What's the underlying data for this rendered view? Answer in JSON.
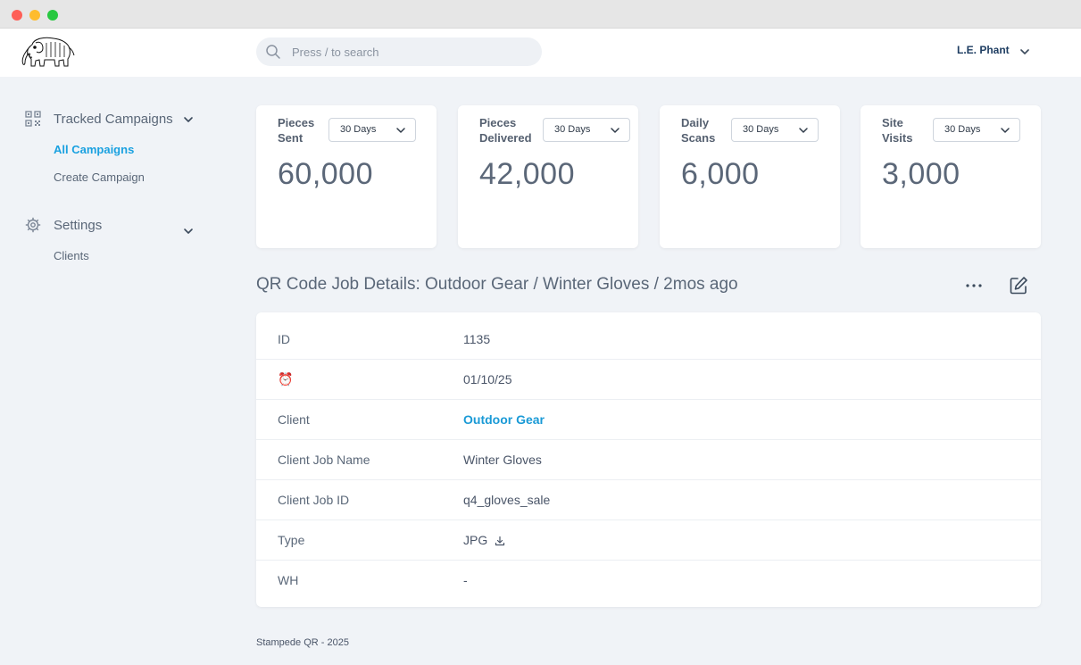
{
  "window": {
    "controls": [
      "close",
      "minimize",
      "zoom"
    ]
  },
  "header": {
    "logo_icon": "elephant-logo-icon",
    "search": {
      "placeholder": "Press / to search",
      "icon": "search-icon"
    },
    "user": {
      "name": "L.E. Phant",
      "icon": "chevron-down-icon"
    }
  },
  "sidebar": {
    "groups": [
      {
        "label": "Tracked Campaigns",
        "icon": "qr-code-icon",
        "items": [
          {
            "label": "All Campaigns",
            "active": true
          },
          {
            "label": "Create Campaign",
            "active": false
          }
        ]
      },
      {
        "label": "Settings",
        "icon": "gear-icon",
        "items": [
          {
            "label": "Clients",
            "active": false
          }
        ]
      }
    ]
  },
  "stats": [
    {
      "label": "Pieces Sent",
      "period": "30 Days",
      "value": "60,000"
    },
    {
      "label": "Pieces Delivered",
      "period": "30 Days",
      "value": "42,000"
    },
    {
      "label": "Daily Scans",
      "period": "30 Days",
      "value": "6,000"
    },
    {
      "label": "Site Visits",
      "period": "30 Days",
      "value": "3,000"
    }
  ],
  "job": {
    "title": "QR Code Job Details: Outdoor Gear / Winter Gloves / 2mos ago",
    "rows": [
      {
        "label": "ID",
        "value": "1135"
      },
      {
        "label": "⏰",
        "value": "01/10/25"
      },
      {
        "label": "Client",
        "value": "Outdoor Gear"
      },
      {
        "label": "Client Job Name",
        "value": "Winter Gloves"
      },
      {
        "label": "Client Job ID",
        "value": "q4_gloves_sale"
      },
      {
        "label": "Type",
        "value": "JPG"
      },
      {
        "label": "WH",
        "value": "-"
      }
    ]
  },
  "footer": {
    "text": "Stampede QR - 2025"
  },
  "colors": {
    "accent": "#1aa1e0",
    "background": "#f0f3f7",
    "user_name": "#1f3e62"
  }
}
